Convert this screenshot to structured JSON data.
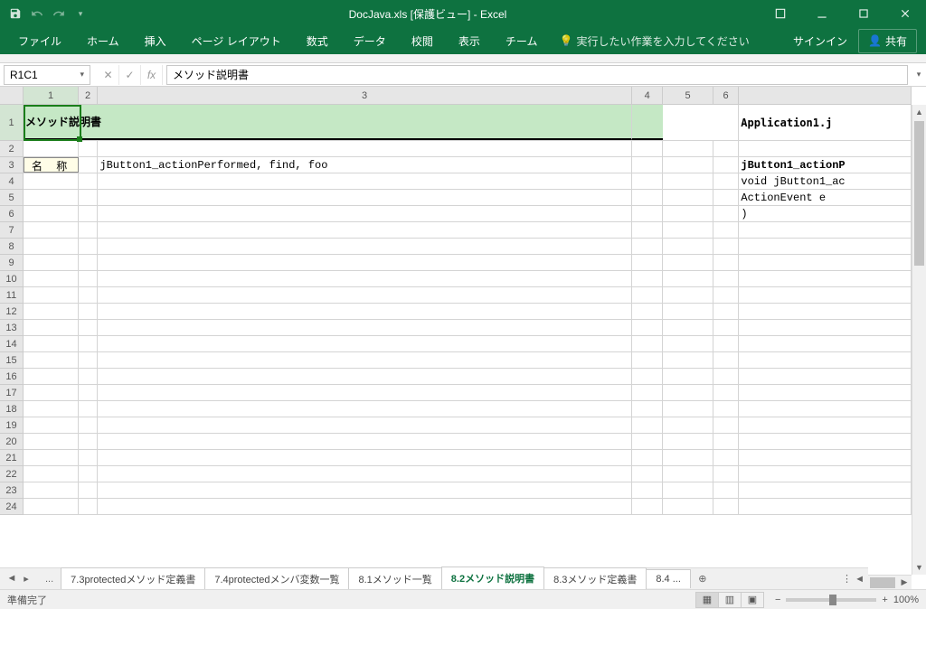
{
  "title": "DocJava.xls  [保護ビュー] - Excel",
  "qat": {
    "save": "save",
    "undo": "undo",
    "redo": "redo"
  },
  "ribbon_tabs": [
    "ファイル",
    "ホーム",
    "挿入",
    "ページ レイアウト",
    "数式",
    "データ",
    "校閲",
    "表示",
    "チーム"
  ],
  "tellme": "実行したい作業を入力してください",
  "signin": "サインイン",
  "share": "共有",
  "namebox": "R1C1",
  "formula": "メソッド説明書",
  "columns": [
    "1",
    "2",
    "3",
    "4",
    "5",
    "6",
    ""
  ],
  "rows_tall": "1",
  "rows": [
    "2",
    "3",
    "4",
    "5",
    "6",
    "7",
    "8",
    "9",
    "10",
    "11",
    "12",
    "13",
    "14",
    "15",
    "16",
    "17",
    "18",
    "19",
    "20",
    "21",
    "22",
    "23",
    "24"
  ],
  "cells": {
    "header_left": "メソッド説明書",
    "header_right": "Application1.j",
    "label": "名 称",
    "r3c3": "jButton1_actionPerformed, find, foo",
    "r3c7": "jButton1_actionP",
    "r4c7": "void jButton1_ac",
    "r5c7": " ActionEvent e",
    "r6c7": ")"
  },
  "sheet_nav": {
    "first": "◄",
    "prev": "‹",
    "dots": "..."
  },
  "sheets": [
    "7.3protectedメソッド定義書",
    "7.4protectedメンバ変数一覧",
    "8.1メソッド一覧",
    "8.2メソッド説明書",
    "8.3メソッド定義書",
    "8.4 ..."
  ],
  "active_sheet": 3,
  "status": "準備完了",
  "zoom": "100%"
}
